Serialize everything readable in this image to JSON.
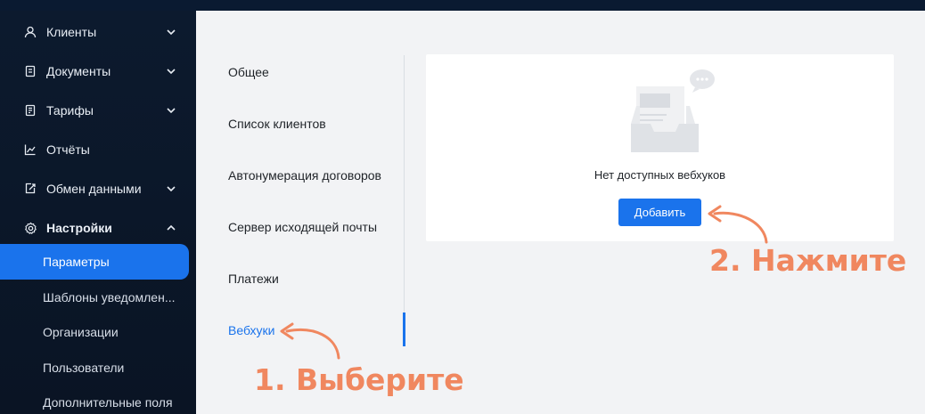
{
  "sidebar": {
    "items": [
      {
        "label": "Клиенты",
        "icon": "user-icon",
        "chevron": "down"
      },
      {
        "label": "Документы",
        "icon": "document-icon",
        "chevron": "down"
      },
      {
        "label": "Тарифы",
        "icon": "tariff-icon",
        "chevron": "down"
      },
      {
        "label": "Отчёты",
        "icon": "chart-icon",
        "chevron": null
      },
      {
        "label": "Обмен данными",
        "icon": "exchange-icon",
        "chevron": "down"
      },
      {
        "label": "Настройки",
        "icon": "gear-icon",
        "chevron": "up"
      }
    ],
    "sub_items": [
      {
        "label": "Параметры",
        "active": true
      },
      {
        "label": "Шаблоны уведомлен..."
      },
      {
        "label": "Организации"
      },
      {
        "label": "Пользователи"
      },
      {
        "label": "Дополнительные поля"
      }
    ]
  },
  "settings_menu": {
    "items": [
      {
        "label": "Общее"
      },
      {
        "label": "Список клиентов"
      },
      {
        "label": "Автонумерация договоров"
      },
      {
        "label": "Сервер исходящей почты"
      },
      {
        "label": "Платежи"
      },
      {
        "label": "Вебхуки",
        "active": true
      }
    ]
  },
  "webhooks": {
    "empty_text": "Нет доступных вебхуков",
    "add_button": "Добавить"
  },
  "annotations": {
    "step1": "1. Выберите",
    "step2": "2. Нажмите"
  },
  "colors": {
    "accent": "#1a73ec",
    "annotation": "#f0875f",
    "sidebar_bg": "#0c1a2e"
  }
}
